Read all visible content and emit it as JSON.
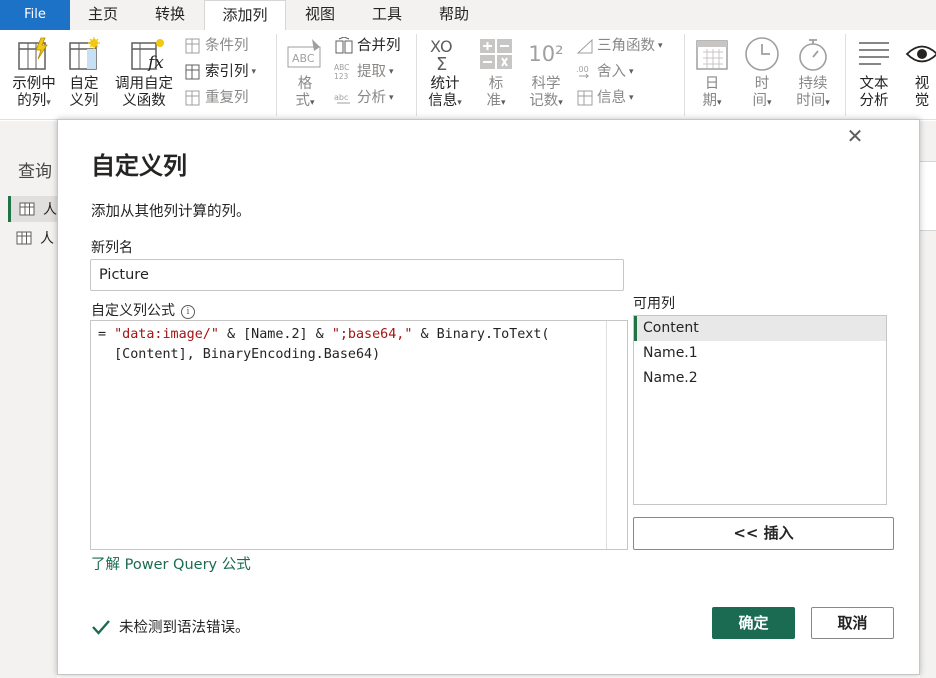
{
  "tabs": {
    "file": "File",
    "home": "主页",
    "transform": "转换",
    "add_column": "添加列",
    "view": "视图",
    "tools": "工具",
    "help": "帮助"
  },
  "ribbon": {
    "column_from_examples": [
      "示例中",
      "的列"
    ],
    "custom_column": [
      "自定",
      "义列"
    ],
    "invoke_custom_function": [
      "调用自定",
      "义函数"
    ],
    "conditional_column": "条件列",
    "index_column": "索引列",
    "duplicate_column": "重复列",
    "format": [
      "格",
      "式"
    ],
    "merge_columns": "合并列",
    "extract": "提取",
    "parse": "分析",
    "statistics": [
      "统计",
      "信息"
    ],
    "standard": [
      "标",
      "准"
    ],
    "scientific": [
      "科学",
      "记数"
    ],
    "trigonometry": "三角函数",
    "rounding": "舍入",
    "information": "信息",
    "date": [
      "日",
      "期"
    ],
    "time": [
      "时",
      "间"
    ],
    "duration": [
      "持续",
      "时间"
    ],
    "text_analytics": [
      "文本",
      "分析"
    ],
    "vision": [
      "视",
      "觉"
    ],
    "sci_icon_text": "10²",
    "abc_icon": "ABC",
    "abc123_icon": [
      "ABC",
      "123"
    ],
    "sigma_icon": [
      "XO",
      "Σ"
    ]
  },
  "queries": {
    "title": "查询",
    "items": [
      "人",
      "人"
    ]
  },
  "dialog": {
    "title": "自定义列",
    "description": "添加从其他列计算的列。",
    "new_column_label": "新列名",
    "new_column_value": "Picture",
    "formula_label": "自定义列公式",
    "formula_parts": {
      "p1": "= ",
      "s1": "\"data:image/\"",
      "p2": " & [Name.2] & ",
      "s2": "\";base64,\"",
      "p3": " & Binary.ToText(\n  [Content], BinaryEncoding.Base64)"
    },
    "learn_link": "了解 Power Query 公式",
    "available_label": "可用列",
    "available_columns": [
      "Content",
      "Name.1",
      "Name.2"
    ],
    "insert_button": "<< 插入",
    "status": "未检测到语法错误。",
    "ok_button": "确定",
    "cancel_button": "取消"
  },
  "colors": {
    "accent_green": "#1a6b52",
    "file_tab_blue": "#1b72c6",
    "string_red": "#a31515"
  }
}
